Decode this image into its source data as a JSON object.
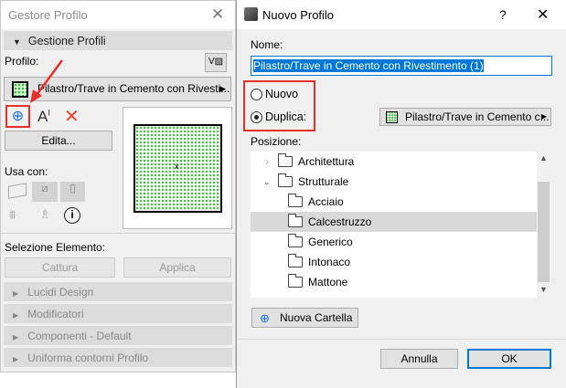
{
  "left_panel": {
    "title": "Gestore Profilo",
    "section": "Gestione Profili",
    "profile_label": "Profilo:",
    "profile_value": "Pilastro/Trave in Cemento con Rivesti...",
    "edit_label": "Edita...",
    "use_with_label": "Usa con:",
    "selection_label": "Selezione Elemento:",
    "capture_label": "Cattura",
    "apply_label": "Applica",
    "collapsed_sections": [
      "Lucidi Design",
      "Modificatori",
      "Componenti - Default",
      "Uniforma contorni Profilo"
    ]
  },
  "dialog": {
    "title": "Nuovo Profilo",
    "help": "?",
    "name_label": "Nome:",
    "name_value": "Pilastro/Trave in Cemento con Rivestimento (1)",
    "radio_new": "Nuovo",
    "radio_duplicate": "Duplica:",
    "selected_radio": "Duplica",
    "duplicate_source": "Pilastro/Trave in Cemento c...",
    "position_label": "Posizione:",
    "tree": [
      {
        "label": "Architettura",
        "level": 0,
        "expand": "collapsed"
      },
      {
        "label": "Strutturale",
        "level": 0,
        "expand": "expanded"
      },
      {
        "label": "Acciaio",
        "level": 1
      },
      {
        "label": "Calcestruzzo",
        "level": 1,
        "selected": true
      },
      {
        "label": "Generico",
        "level": 1
      },
      {
        "label": "Intonaco",
        "level": 1
      },
      {
        "label": "Mattone",
        "level": 1
      }
    ],
    "new_folder": "Nuova Cartella",
    "cancel": "Annulla",
    "ok": "OK"
  },
  "colors": {
    "highlight": "#e8302a",
    "selection": "#0078d7",
    "accent_blue": "#1a6fe0"
  }
}
